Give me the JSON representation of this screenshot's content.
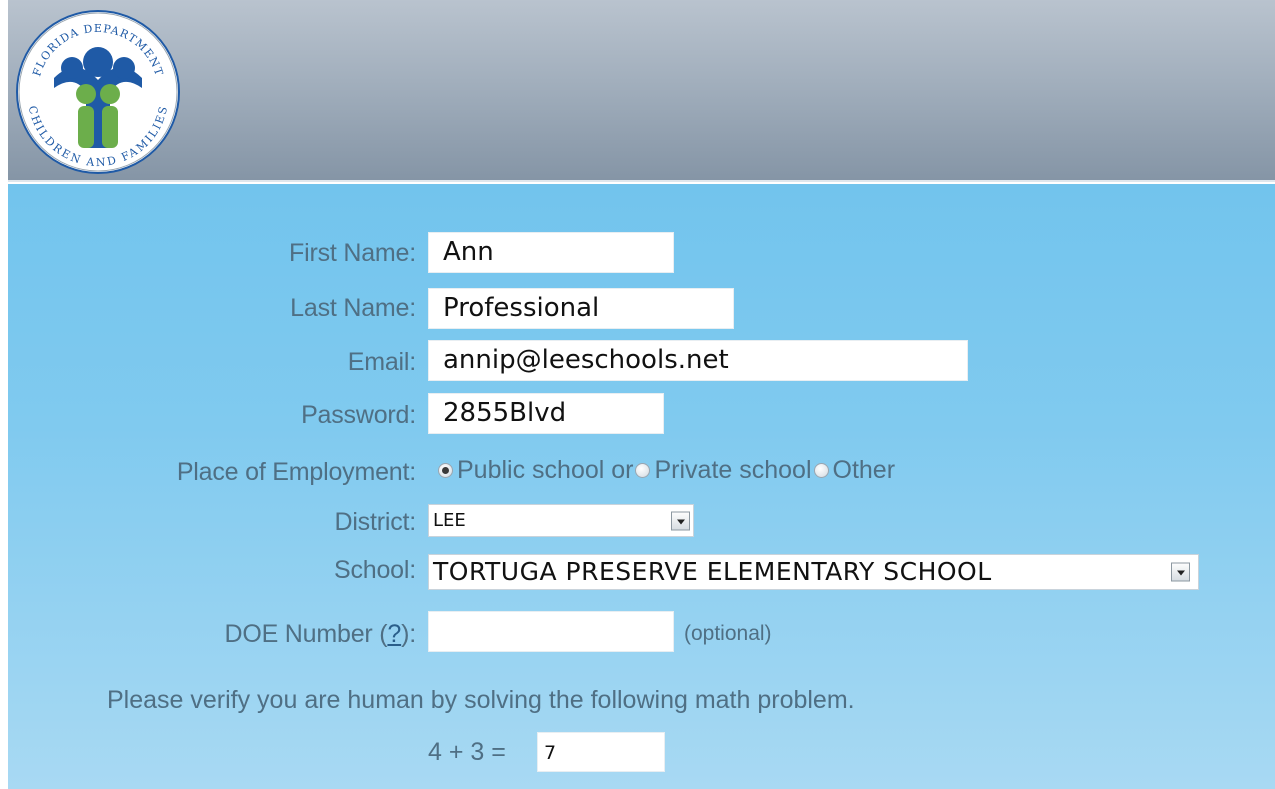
{
  "header": {
    "logo_text_top": "FLORIDA DEPARTMENT",
    "logo_text_bottom": "CHILDREN AND FAMILIES",
    "logo_text_of": "OF"
  },
  "form": {
    "first_name_label": "First Name:",
    "first_name_value": "Ann",
    "last_name_label": "Last Name:",
    "last_name_value": "Professional",
    "email_label": "Email:",
    "email_value": "annip@leeschools.net",
    "password_label": "Password:",
    "password_value": "2855Blvd",
    "employment_label": "Place of Employment:",
    "employment_options": [
      "Public school or",
      "Private school",
      "Other"
    ],
    "employment_selected": "Public school or",
    "district_label": "District:",
    "district_value": "LEE",
    "school_label": "School:",
    "school_value": "TORTUGA PRESERVE ELEMENTARY SCHOOL",
    "doe_label_prefix": "DOE Number (",
    "doe_help": "?",
    "doe_label_suffix": "):",
    "doe_value": "",
    "doe_hint": "(optional)",
    "verify_text": "Please verify you are human by solving the following math problem.",
    "math_problem": "4 + 3 =",
    "math_answer": "7"
  },
  "colors": {
    "header_gradient_top": "#b9c3ce",
    "header_gradient_bottom": "#8595a6",
    "form_background": "#7cc8ee",
    "label_text": "#4f6f84",
    "logo_blue": "#1f5aa6",
    "logo_green": "#6cae4b"
  }
}
